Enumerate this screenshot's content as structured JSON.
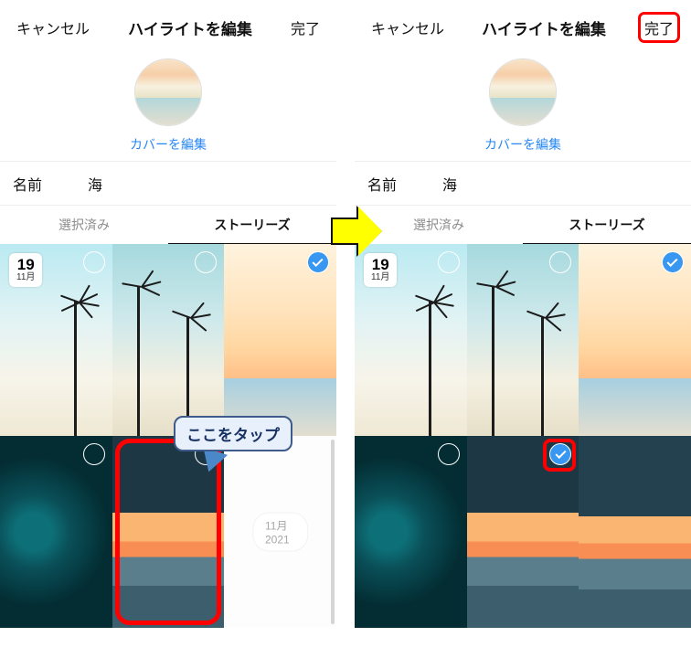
{
  "header": {
    "cancel": "キャンセル",
    "title": "ハイライトを編集",
    "done": "完了"
  },
  "cover": {
    "edit": "カバーを編集"
  },
  "name": {
    "label": "名前",
    "value": "海"
  },
  "tabs": {
    "selected": "選択済み",
    "stories": "ストーリーズ"
  },
  "date_badge": {
    "day": "19",
    "month": "11月"
  },
  "month_pill": "11月 2021",
  "annotation": {
    "tap_here": "ここをタップ"
  }
}
